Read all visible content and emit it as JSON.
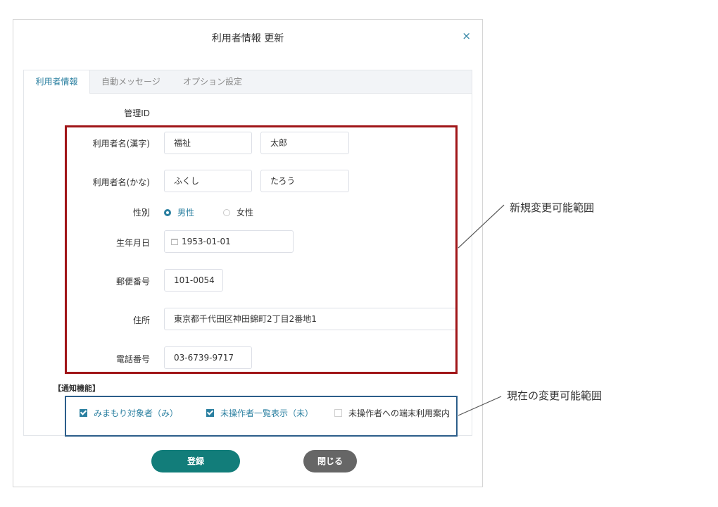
{
  "dialog": {
    "title": "利用者情報 更新",
    "close_symbol": "×",
    "tabs": [
      {
        "label": "利用者情報",
        "active": true
      },
      {
        "label": "自動メッセージ",
        "active": false
      },
      {
        "label": "オプション設定",
        "active": false
      }
    ]
  },
  "form": {
    "manage_id_label": "管理ID",
    "name_kanji_label": "利用者名(漢字)",
    "name_kanji_last": "福祉",
    "name_kanji_first": "太郎",
    "name_kana_label": "利用者名(かな)",
    "name_kana_last": "ふくし",
    "name_kana_first": "たろう",
    "gender_label": "性別",
    "gender_male": "男性",
    "gender_female": "女性",
    "gender_selected": "男性",
    "birthdate_label": "生年月日",
    "birthdate_value": "1953-01-01",
    "postal_label": "郵便番号",
    "postal_value": "101-0054",
    "address_label": "住所",
    "address_value": "東京都千代田区神田錦町2丁目2番地1",
    "phone_label": "電話番号",
    "phone_value": "03-6739-9717"
  },
  "notify": {
    "section_title": "【通知機能】",
    "options": [
      {
        "label": "みまもり対象者（み）",
        "checked": true
      },
      {
        "label": "未操作者一覧表示（未）",
        "checked": true
      },
      {
        "label": "未操作者への端末利用案内",
        "checked": false
      }
    ]
  },
  "buttons": {
    "register": "登録",
    "close": "閉じる"
  },
  "annotations": {
    "new_range": "新規変更可能範囲",
    "current_range": "現在の変更可能範囲"
  },
  "colors": {
    "accent": "#2a7fa0",
    "register_button": "#127d7a",
    "close_button": "#666666",
    "new_range_border": "#a01518",
    "current_range_border": "#2c5e8a"
  }
}
